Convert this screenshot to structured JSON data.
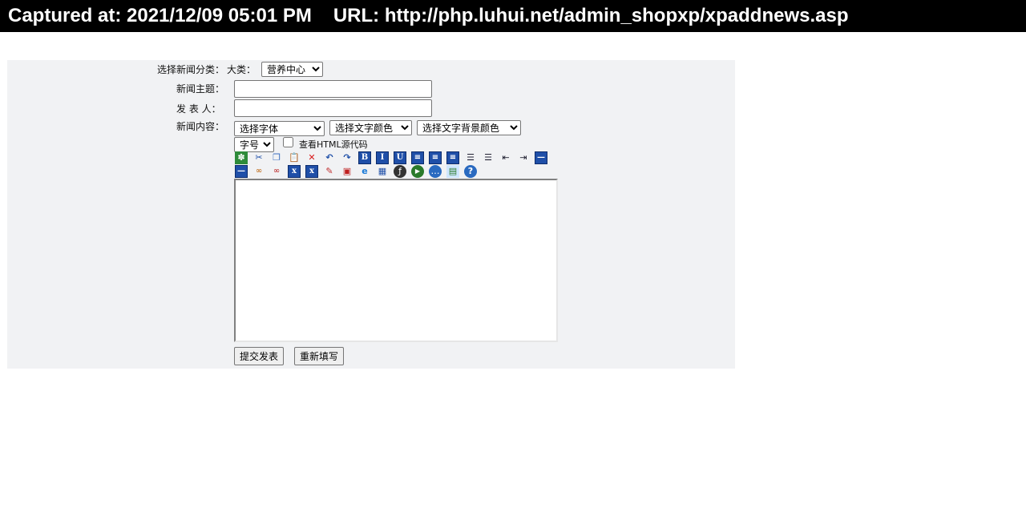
{
  "capture_bar": {
    "captured": "Captured at: 2021/12/09 05:01 PM",
    "url": "URL: http://php.luhui.net/admin_shopxp/xpaddnews.asp"
  },
  "form": {
    "category_label": "选择新闻分类：",
    "major_label": "大类：",
    "major_select_value": "营养中心",
    "title_label": "新闻主题：",
    "author_label": "发 表 人：",
    "content_label": "新闻内容：",
    "font_select_value": "选择字体",
    "color_select_value": "选择文字颜色",
    "bgcolor_select_value": "选择文字背景颜色",
    "size_select_value": "字号",
    "html_toggle_label": "查看HTML源代码",
    "submit_label": "提交发表",
    "reset_label": "重新填写"
  },
  "toolbar": {
    "row1": [
      {
        "name": "fullscreen-icon",
        "glyph": "✽"
      },
      {
        "name": "cut-icon",
        "glyph": "✂"
      },
      {
        "name": "copy-icon",
        "glyph": "❐"
      },
      {
        "name": "paste-icon",
        "glyph": "📋"
      },
      {
        "name": "delete-icon",
        "glyph": "✕"
      },
      {
        "name": "undo-icon",
        "glyph": "↶"
      },
      {
        "name": "redo-icon",
        "glyph": "↷"
      },
      {
        "name": "bold-icon",
        "glyph": "B"
      },
      {
        "name": "italic-icon",
        "glyph": "I"
      },
      {
        "name": "underline-icon",
        "glyph": "U"
      },
      {
        "name": "align-left-icon",
        "glyph": "≡"
      },
      {
        "name": "align-center-icon",
        "glyph": "≡"
      },
      {
        "name": "align-right-icon",
        "glyph": "≡"
      },
      {
        "name": "ordered-list-icon",
        "glyph": "☰"
      },
      {
        "name": "unordered-list-icon",
        "glyph": "☰"
      },
      {
        "name": "outdent-icon",
        "glyph": "⇤"
      },
      {
        "name": "indent-icon",
        "glyph": "⇥"
      },
      {
        "name": "horizontal-rule-icon",
        "glyph": "—"
      }
    ],
    "row2": [
      {
        "name": "remove-format-icon",
        "glyph": "—"
      },
      {
        "name": "web-link-icon",
        "glyph": "∞"
      },
      {
        "name": "unlink-icon",
        "glyph": "∞"
      },
      {
        "name": "subscript-icon",
        "glyph": "x"
      },
      {
        "name": "superscript-icon",
        "glyph": "x"
      },
      {
        "name": "eraser-icon",
        "glyph": "✎"
      },
      {
        "name": "insert-image-icon",
        "glyph": "▣"
      },
      {
        "name": "ie-link-icon",
        "glyph": "e"
      },
      {
        "name": "table-icon",
        "glyph": "▦"
      },
      {
        "name": "flash-icon",
        "glyph": "ƒ"
      },
      {
        "name": "media-icon",
        "glyph": "▶"
      },
      {
        "name": "comment-icon",
        "glyph": "…"
      },
      {
        "name": "picture-icon",
        "glyph": "▤"
      },
      {
        "name": "help-icon",
        "glyph": "?"
      }
    ]
  },
  "colors": {
    "panel_background": "#f1f2f4",
    "capture_bar_background": "#000000",
    "toolbar_blue": "#1f4fa8"
  }
}
